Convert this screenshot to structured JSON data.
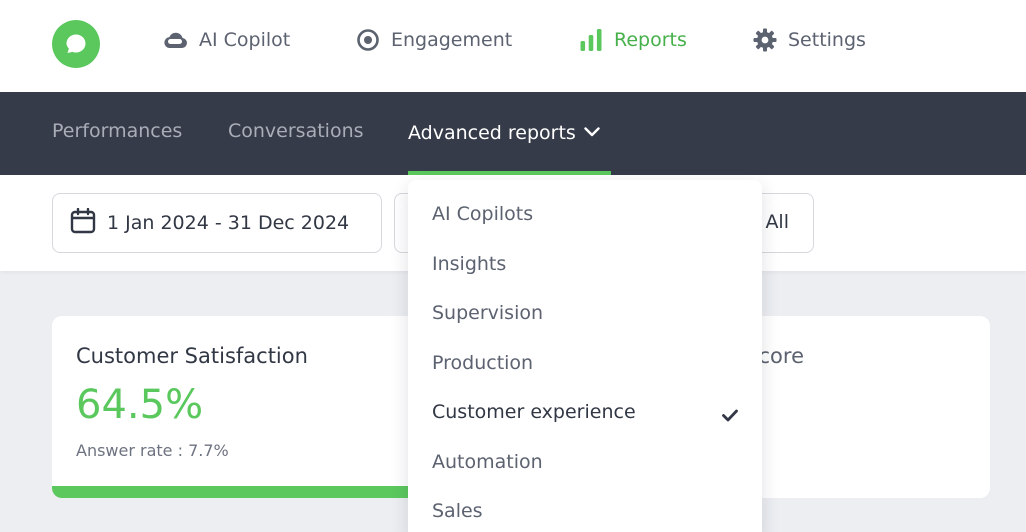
{
  "top_nav": {
    "logo_icon": "chat-bubble-icon",
    "items": [
      {
        "label": "AI Copilot",
        "icon": "cloud-icon",
        "active": false
      },
      {
        "label": "Engagement",
        "icon": "target-icon",
        "active": false
      },
      {
        "label": "Reports",
        "icon": "bar-chart-icon",
        "active": true
      },
      {
        "label": "Settings",
        "icon": "gear-icon",
        "active": false
      }
    ]
  },
  "sub_nav": {
    "tabs": [
      {
        "label": "Performances",
        "active": false
      },
      {
        "label": "Conversations",
        "active": false
      },
      {
        "label": "Advanced reports",
        "active": true
      }
    ]
  },
  "filters": {
    "date_range": "1 Jan 2024 - 31 Dec 2024",
    "second_filter_value": "All"
  },
  "dropdown": {
    "items": [
      {
        "label": "AI Copilots",
        "selected": false
      },
      {
        "label": "Insights",
        "selected": false
      },
      {
        "label": "Supervision",
        "selected": false
      },
      {
        "label": "Production",
        "selected": false
      },
      {
        "label": "Customer experience",
        "selected": true
      },
      {
        "label": "Automation",
        "selected": false
      },
      {
        "label": "Sales",
        "selected": false
      }
    ]
  },
  "cards": [
    {
      "title": "Customer Satisfaction",
      "value": "64.5%",
      "subtitle": "Answer rate : 7.7%",
      "progress": 1.0
    },
    {
      "title_visible_fragment": "core"
    }
  ],
  "colors": {
    "accent": "#5bc85e",
    "subnav_bg": "#363b49",
    "page_bg": "#eceef2"
  }
}
